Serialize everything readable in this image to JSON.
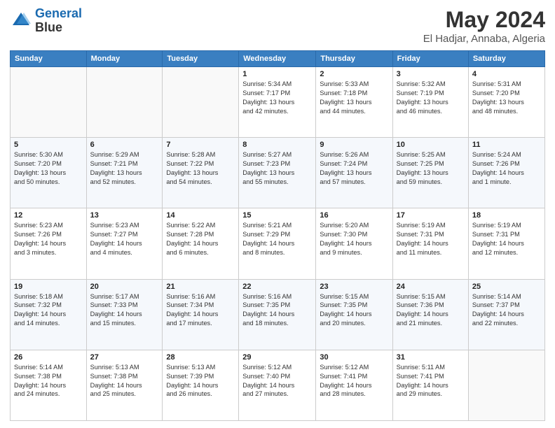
{
  "header": {
    "logo_line1": "General",
    "logo_line2": "Blue",
    "title": "May 2024",
    "subtitle": "El Hadjar, Annaba, Algeria"
  },
  "columns": [
    "Sunday",
    "Monday",
    "Tuesday",
    "Wednesday",
    "Thursday",
    "Friday",
    "Saturday"
  ],
  "weeks": [
    [
      {
        "day": "",
        "info": ""
      },
      {
        "day": "",
        "info": ""
      },
      {
        "day": "",
        "info": ""
      },
      {
        "day": "1",
        "info": "Sunrise: 5:34 AM\nSunset: 7:17 PM\nDaylight: 13 hours\nand 42 minutes."
      },
      {
        "day": "2",
        "info": "Sunrise: 5:33 AM\nSunset: 7:18 PM\nDaylight: 13 hours\nand 44 minutes."
      },
      {
        "day": "3",
        "info": "Sunrise: 5:32 AM\nSunset: 7:19 PM\nDaylight: 13 hours\nand 46 minutes."
      },
      {
        "day": "4",
        "info": "Sunrise: 5:31 AM\nSunset: 7:20 PM\nDaylight: 13 hours\nand 48 minutes."
      }
    ],
    [
      {
        "day": "5",
        "info": "Sunrise: 5:30 AM\nSunset: 7:20 PM\nDaylight: 13 hours\nand 50 minutes."
      },
      {
        "day": "6",
        "info": "Sunrise: 5:29 AM\nSunset: 7:21 PM\nDaylight: 13 hours\nand 52 minutes."
      },
      {
        "day": "7",
        "info": "Sunrise: 5:28 AM\nSunset: 7:22 PM\nDaylight: 13 hours\nand 54 minutes."
      },
      {
        "day": "8",
        "info": "Sunrise: 5:27 AM\nSunset: 7:23 PM\nDaylight: 13 hours\nand 55 minutes."
      },
      {
        "day": "9",
        "info": "Sunrise: 5:26 AM\nSunset: 7:24 PM\nDaylight: 13 hours\nand 57 minutes."
      },
      {
        "day": "10",
        "info": "Sunrise: 5:25 AM\nSunset: 7:25 PM\nDaylight: 13 hours\nand 59 minutes."
      },
      {
        "day": "11",
        "info": "Sunrise: 5:24 AM\nSunset: 7:26 PM\nDaylight: 14 hours\nand 1 minute."
      }
    ],
    [
      {
        "day": "12",
        "info": "Sunrise: 5:23 AM\nSunset: 7:26 PM\nDaylight: 14 hours\nand 3 minutes."
      },
      {
        "day": "13",
        "info": "Sunrise: 5:23 AM\nSunset: 7:27 PM\nDaylight: 14 hours\nand 4 minutes."
      },
      {
        "day": "14",
        "info": "Sunrise: 5:22 AM\nSunset: 7:28 PM\nDaylight: 14 hours\nand 6 minutes."
      },
      {
        "day": "15",
        "info": "Sunrise: 5:21 AM\nSunset: 7:29 PM\nDaylight: 14 hours\nand 8 minutes."
      },
      {
        "day": "16",
        "info": "Sunrise: 5:20 AM\nSunset: 7:30 PM\nDaylight: 14 hours\nand 9 minutes."
      },
      {
        "day": "17",
        "info": "Sunrise: 5:19 AM\nSunset: 7:31 PM\nDaylight: 14 hours\nand 11 minutes."
      },
      {
        "day": "18",
        "info": "Sunrise: 5:19 AM\nSunset: 7:31 PM\nDaylight: 14 hours\nand 12 minutes."
      }
    ],
    [
      {
        "day": "19",
        "info": "Sunrise: 5:18 AM\nSunset: 7:32 PM\nDaylight: 14 hours\nand 14 minutes."
      },
      {
        "day": "20",
        "info": "Sunrise: 5:17 AM\nSunset: 7:33 PM\nDaylight: 14 hours\nand 15 minutes."
      },
      {
        "day": "21",
        "info": "Sunrise: 5:16 AM\nSunset: 7:34 PM\nDaylight: 14 hours\nand 17 minutes."
      },
      {
        "day": "22",
        "info": "Sunrise: 5:16 AM\nSunset: 7:35 PM\nDaylight: 14 hours\nand 18 minutes."
      },
      {
        "day": "23",
        "info": "Sunrise: 5:15 AM\nSunset: 7:35 PM\nDaylight: 14 hours\nand 20 minutes."
      },
      {
        "day": "24",
        "info": "Sunrise: 5:15 AM\nSunset: 7:36 PM\nDaylight: 14 hours\nand 21 minutes."
      },
      {
        "day": "25",
        "info": "Sunrise: 5:14 AM\nSunset: 7:37 PM\nDaylight: 14 hours\nand 22 minutes."
      }
    ],
    [
      {
        "day": "26",
        "info": "Sunrise: 5:14 AM\nSunset: 7:38 PM\nDaylight: 14 hours\nand 24 minutes."
      },
      {
        "day": "27",
        "info": "Sunrise: 5:13 AM\nSunset: 7:38 PM\nDaylight: 14 hours\nand 25 minutes."
      },
      {
        "day": "28",
        "info": "Sunrise: 5:13 AM\nSunset: 7:39 PM\nDaylight: 14 hours\nand 26 minutes."
      },
      {
        "day": "29",
        "info": "Sunrise: 5:12 AM\nSunset: 7:40 PM\nDaylight: 14 hours\nand 27 minutes."
      },
      {
        "day": "30",
        "info": "Sunrise: 5:12 AM\nSunset: 7:41 PM\nDaylight: 14 hours\nand 28 minutes."
      },
      {
        "day": "31",
        "info": "Sunrise: 5:11 AM\nSunset: 7:41 PM\nDaylight: 14 hours\nand 29 minutes."
      },
      {
        "day": "",
        "info": ""
      }
    ]
  ]
}
